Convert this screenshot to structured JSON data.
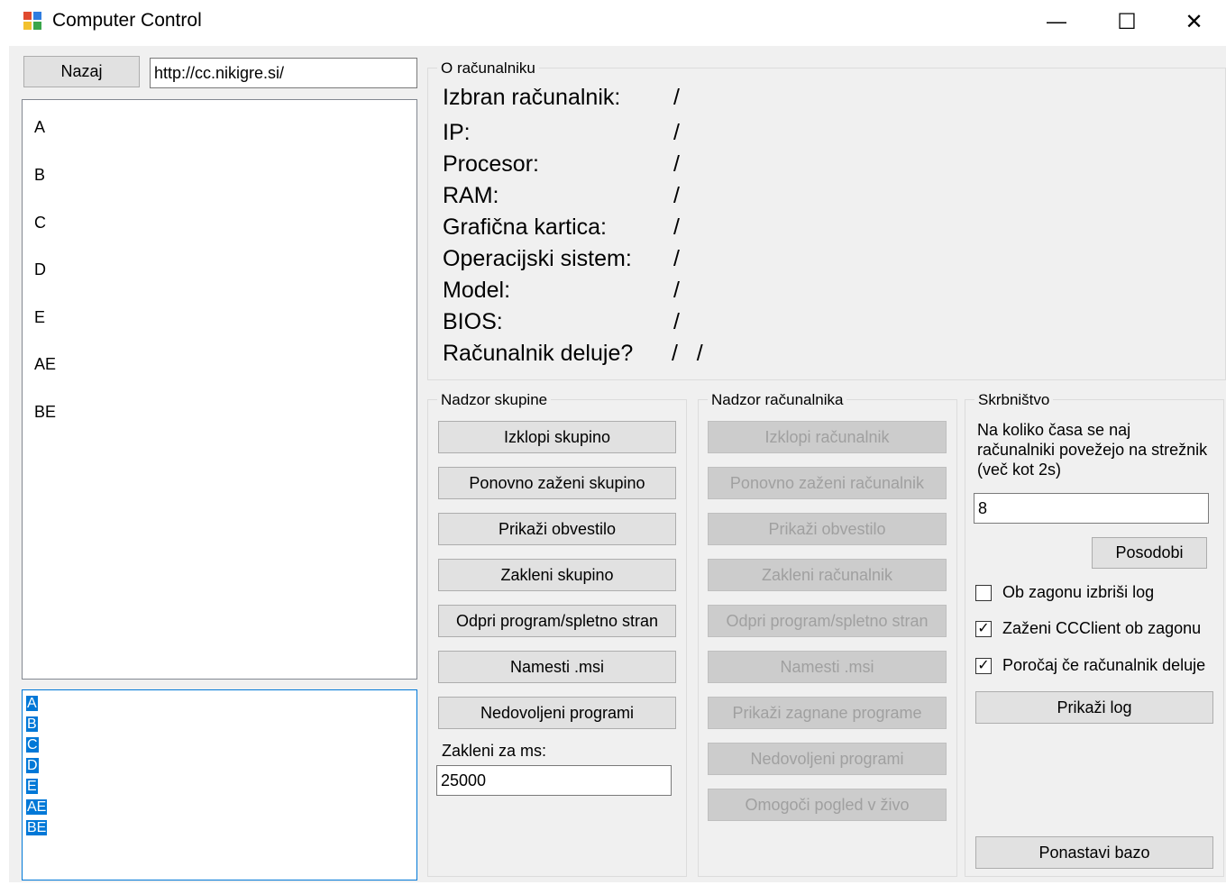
{
  "window": {
    "title": "Computer Control",
    "controls": {
      "minimize": "—",
      "maximize": "☐",
      "close": "✕"
    }
  },
  "nav": {
    "back_label": "Nazaj",
    "url_value": "http://cc.nikigre.si/"
  },
  "computer_list": [
    "A",
    "B",
    "C",
    "D",
    "E",
    "AE",
    "BE"
  ],
  "selected_list": [
    "A",
    "B",
    "C",
    "D",
    "E",
    "AE",
    "BE"
  ],
  "about": {
    "title": "O računalniku",
    "rows": [
      {
        "label": "Izbran računalnik:",
        "value": "/"
      },
      {
        "label": "IP:",
        "value": "/"
      },
      {
        "label": "Procesor:",
        "value": "/"
      },
      {
        "label": "RAM:",
        "value": "/"
      },
      {
        "label": "Grafična kartica:",
        "value": "/"
      },
      {
        "label": "Operacijski sistem:",
        "value": "/"
      },
      {
        "label": "Model:",
        "value": "/"
      },
      {
        "label": "BIOS:",
        "value": "/"
      },
      {
        "label": "Računalnik deluje?",
        "value": "/   /"
      }
    ]
  },
  "group_control": {
    "title": "Nadzor skupine",
    "buttons": [
      "Izklopi skupino",
      "Ponovno zaženi skupino",
      "Prikaži obvestilo",
      "Zakleni skupino",
      "Odpri program/spletno stran",
      "Namesti .msi",
      "Nedovoljeni programi"
    ],
    "lock_label": "Zakleni za ms:",
    "lock_value": "25000"
  },
  "computer_control": {
    "title": "Nadzor računalnika",
    "buttons": [
      "Izklopi računalnik",
      "Ponovno zaženi računalnik",
      "Prikaži obvestilo",
      "Zakleni računalnik",
      "Odpri program/spletno stran",
      "Namesti .msi",
      "Prikaži zagnane programe",
      "Nedovoljeni programi",
      "Omogoči pogled v živo"
    ]
  },
  "admin": {
    "title": "Skrbništvo",
    "interval_label": "Na koliko časa se naj računalniki povežejo na strežnik (več kot 2s)",
    "interval_value": "8",
    "update_label": "Posodobi",
    "checkboxes": [
      {
        "label": "Ob zagonu izbriši log",
        "checked": false,
        "mark": ""
      },
      {
        "label": "Zaženi CCClient ob zagonu",
        "checked": true,
        "mark": "✓"
      },
      {
        "label": "Poročaj če računalnik deluje",
        "checked": true,
        "mark": "✓"
      }
    ],
    "show_log_label": "Prikaži log",
    "reset_db_label": "Ponastavi bazo"
  }
}
